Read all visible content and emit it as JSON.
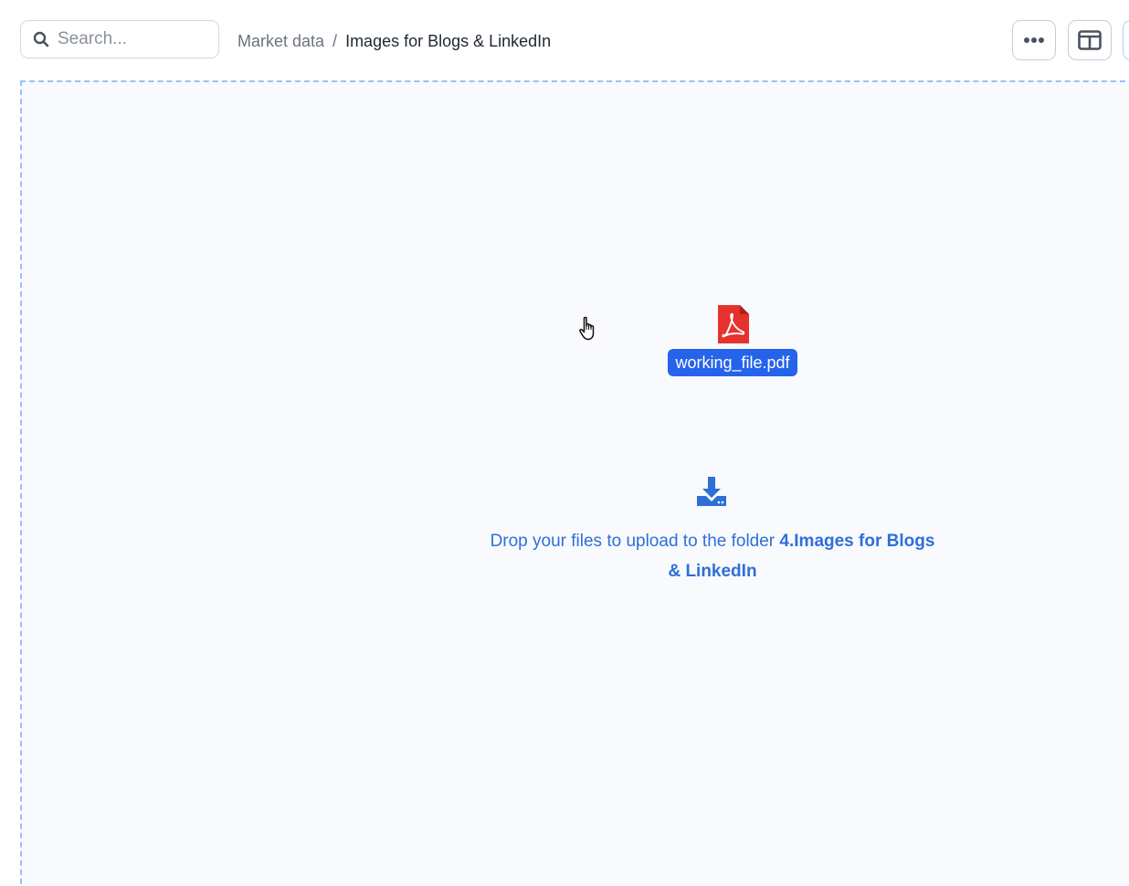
{
  "search": {
    "placeholder": "Search..."
  },
  "breadcrumb": {
    "parent": "Market data",
    "separator": "/",
    "current": "Images for Blogs & LinkedIn"
  },
  "toolbar": {
    "more_icon": "more-horizontal-icon",
    "layout_icon": "split-panel-icon"
  },
  "file": {
    "name": "working_file.pdf",
    "icon": "pdf-file-icon",
    "icon_color": "#e5322d",
    "label_color": "#2563eb"
  },
  "dropzone": {
    "icon": "download-tray-icon",
    "text_prefix": "Drop your files to upload to the folder ",
    "folder_name": "4.Images for Blogs & LinkedIn",
    "text_color": "#2f6fd8",
    "border_color": "#9cc0f2"
  }
}
